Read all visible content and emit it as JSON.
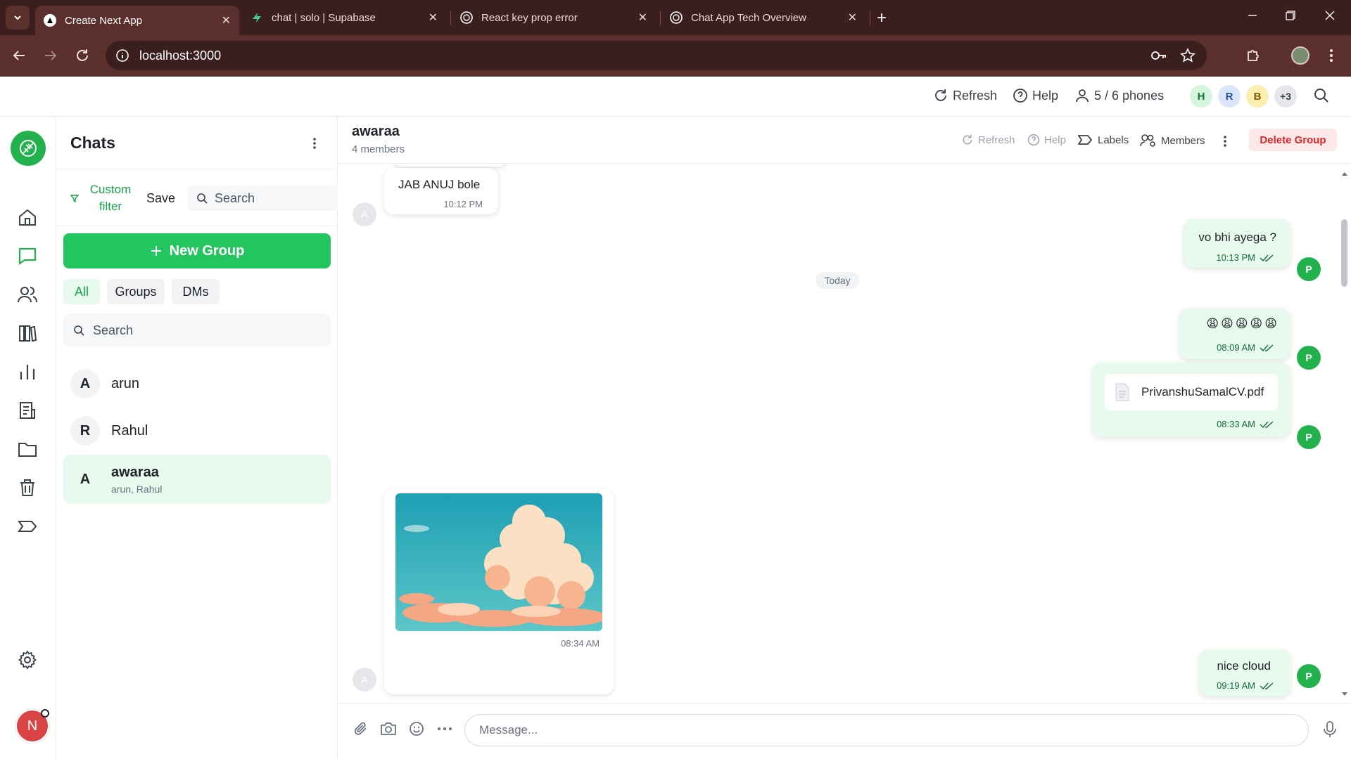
{
  "browser": {
    "tabs": [
      {
        "title": "Create Next App",
        "active": true
      },
      {
        "title": "chat | solo | Supabase",
        "active": false
      },
      {
        "title": "React key prop error",
        "active": false
      },
      {
        "title": "Chat App Tech Overview",
        "active": false
      }
    ],
    "url": "localhost:3000"
  },
  "header": {
    "refresh_label": "Refresh",
    "help_label": "Help",
    "phones_label": "5 / 6 phones",
    "avatars": [
      {
        "letter": "H",
        "color": "#d6f5df",
        "text_color": "#146c3a"
      },
      {
        "letter": "R",
        "color": "#dbe6fb",
        "text_color": "#2b4fa8"
      },
      {
        "letter": "B",
        "color": "#fbeeb0",
        "text_color": "#7a5b00"
      }
    ],
    "more_count": "+3"
  },
  "chats_panel": {
    "title": "Chats",
    "custom_filter_label": "Custom filter",
    "save_label": "Save",
    "filter_search_placeholder": "Search",
    "new_group_label": "New Group",
    "filters": [
      "All",
      "Groups",
      "DMs"
    ],
    "search_placeholder": "Search",
    "items": [
      {
        "initial": "A",
        "name": "arun",
        "subtitle": ""
      },
      {
        "initial": "R",
        "name": "Rahul",
        "subtitle": ""
      },
      {
        "initial": "A",
        "name": "awaraa",
        "subtitle": "arun, Rahul"
      }
    ]
  },
  "conversation": {
    "title": "awaraa",
    "subtitle": "4 members",
    "actions": {
      "refresh": "Refresh",
      "help": "Help",
      "labels": "Labels",
      "members": "Members",
      "delete": "Delete Group"
    },
    "messages": [
      {
        "sender": "A",
        "text": "JAB ANUJ bole",
        "time": "10:12 PM"
      },
      {
        "sender": "P",
        "text": "vo bhi ayega ?",
        "time": "10:13 PM"
      },
      {
        "divider": "Today"
      },
      {
        "sender": "P",
        "text": "😩😩😩😩😩",
        "time": "08:09 AM"
      },
      {
        "sender": "P",
        "file": "PrivanshuSamalCV.pdf",
        "time": "08:33 AM"
      },
      {
        "sender": "A",
        "image": "clouds",
        "time": "08:34 AM"
      },
      {
        "sender": "P",
        "text": "nice cloud",
        "time": "09:19 AM"
      }
    ],
    "composer_placeholder": "Message..."
  },
  "user_avatar_letter": "N",
  "colors": {
    "brand_green": "#22c55e",
    "bubble_me": "#e8f9ed",
    "delete_bg": "#fde8e8",
    "delete_text": "#dc2626",
    "chrome_dark": "#3b1f1e",
    "chrome_mid": "#5b2f2c"
  }
}
